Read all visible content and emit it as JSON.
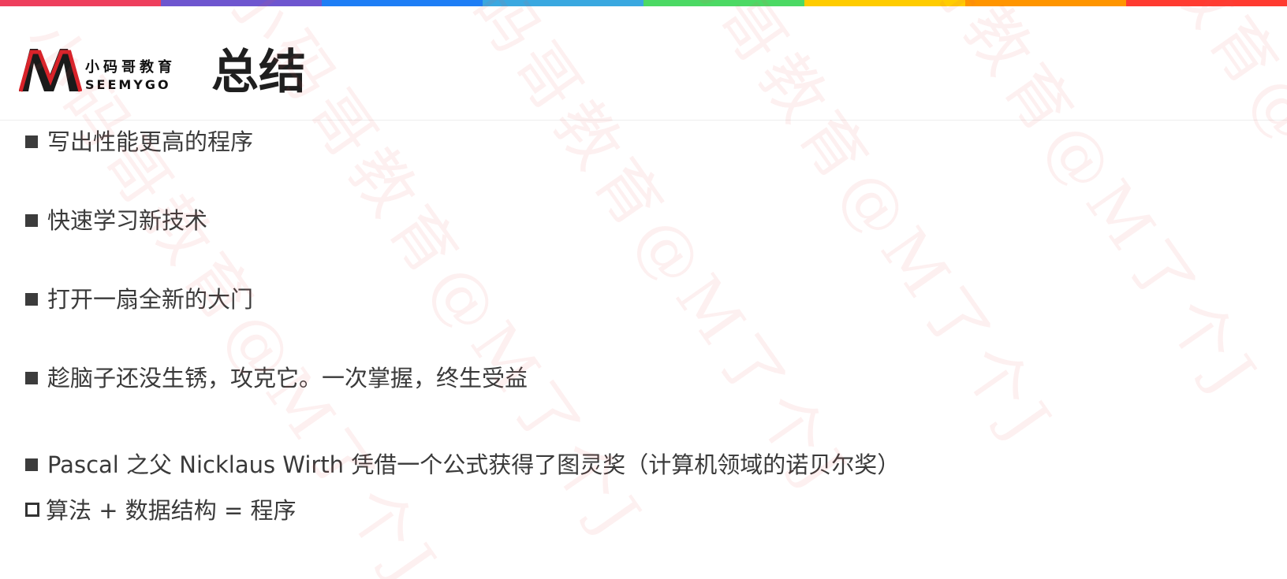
{
  "rainbow_colors": [
    "#ee3f5d",
    "#6e56cf",
    "#1e7ef5",
    "#3aa8e0",
    "#4cd964",
    "#ffcc00",
    "#ff9500",
    "#ff3b30"
  ],
  "logo": {
    "cn_text": "小码哥教育",
    "en_text": "SEEMYGO"
  },
  "title": "总结",
  "bullets": [
    {
      "text": "写出性能更高的程序",
      "style": "filled"
    },
    {
      "text": "快速学习新技术",
      "style": "filled"
    },
    {
      "text": "打开一扇全新的大门",
      "style": "filled"
    },
    {
      "text": "趁脑子还没生锈，攻克它。一次掌握，终生受益",
      "style": "filled"
    },
    {
      "text": "Pascal 之父 Nicklaus Wirth 凭借一个公式获得了图灵奖（计算机领域的诺贝尔奖）",
      "style": "filled"
    },
    {
      "text": "算法 + 数据结构 = 程序",
      "style": "hollow"
    }
  ],
  "watermark_text": "小码哥教育@M了个J"
}
